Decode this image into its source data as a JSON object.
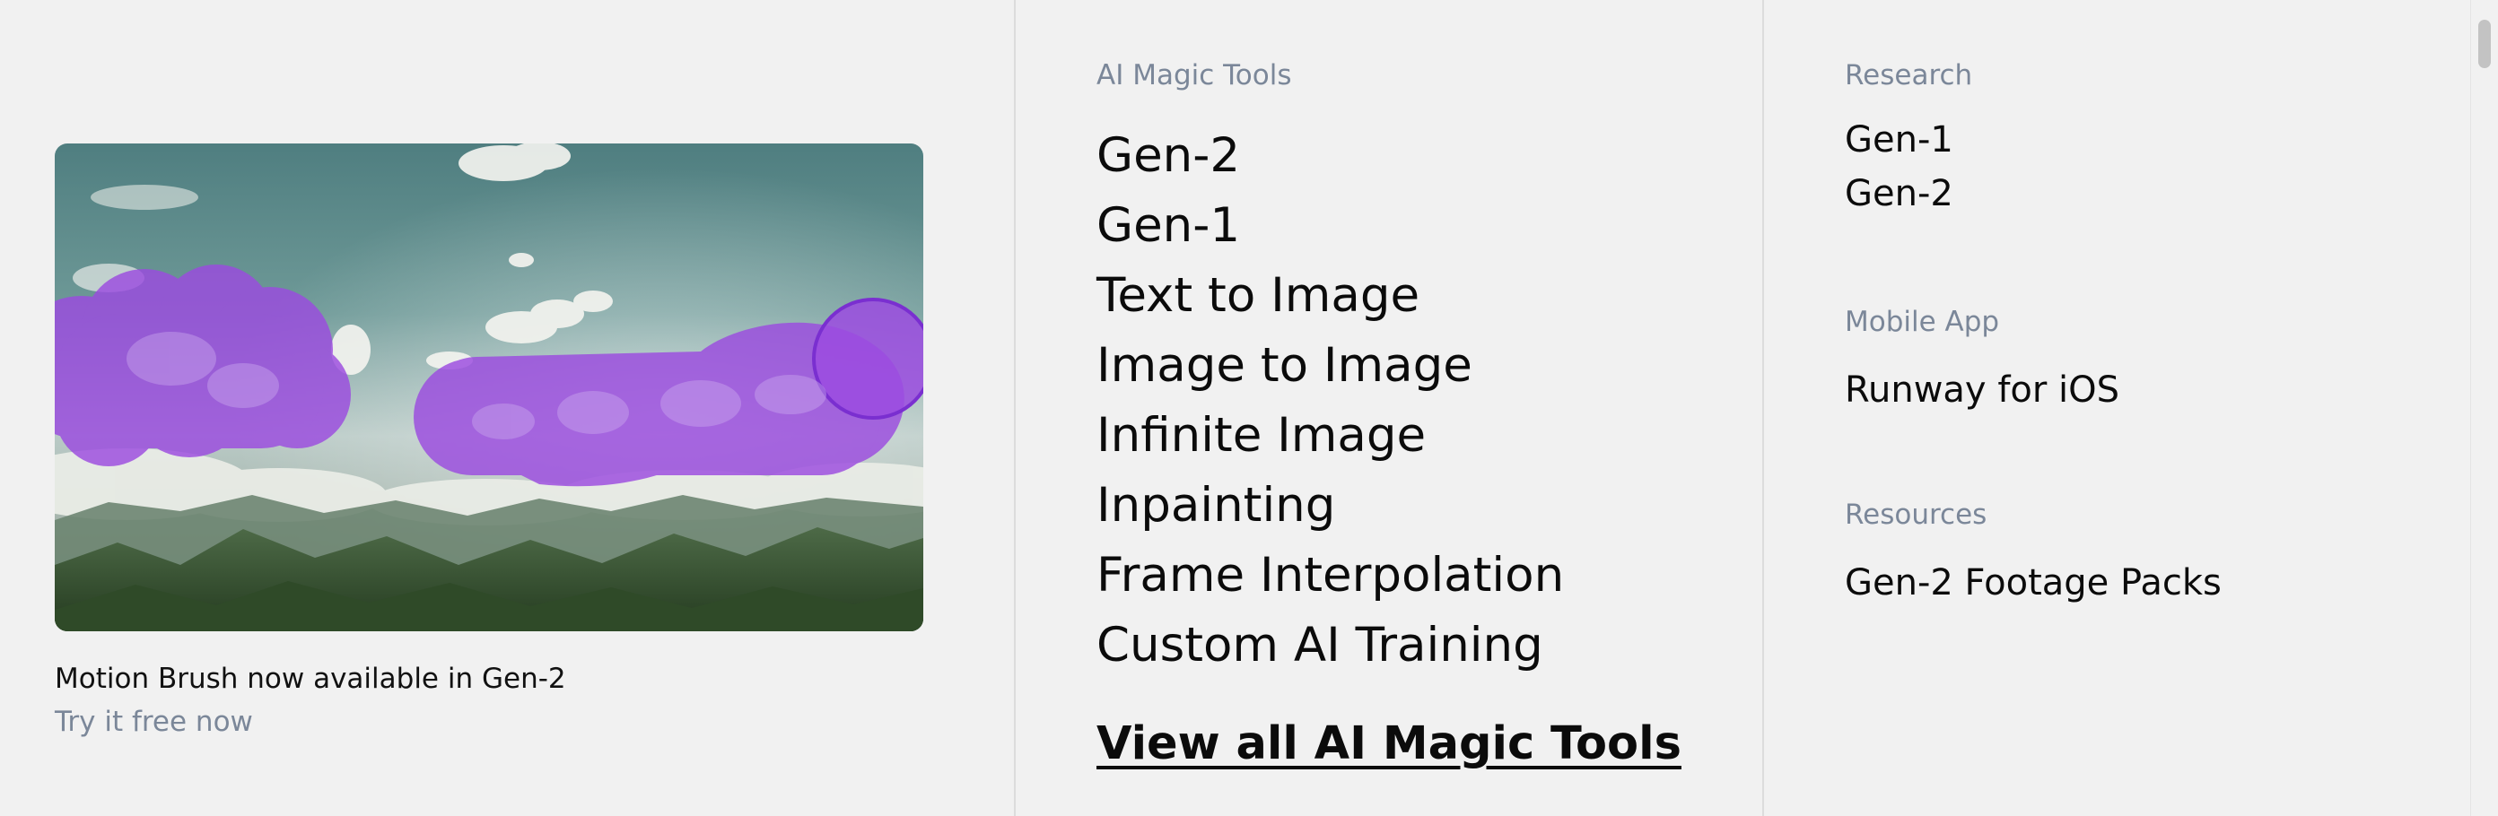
{
  "promo": {
    "image_alt": "Motion Brush preview: clouds over green mountains with purple brush strokes",
    "title": "Motion Brush now available in Gen-2",
    "cta": "Try it free now",
    "brush_color": "#9b4be0"
  },
  "ai_tools": {
    "heading": "AI Magic Tools",
    "items": [
      "Gen-2",
      "Gen-1",
      "Text to Image",
      "Image to Image",
      "Infinite Image",
      "Inpainting",
      "Frame Interpolation",
      "Custom AI Training"
    ],
    "view_all": "View all AI Magic Tools"
  },
  "research": {
    "heading": "Research",
    "items": [
      "Gen-1",
      "Gen-2"
    ]
  },
  "mobile": {
    "heading": "Mobile App",
    "items": [
      "Runway for iOS"
    ]
  },
  "resources": {
    "heading": "Resources",
    "items": [
      "Gen-2 Footage Packs"
    ]
  },
  "colors": {
    "background": "#f1f1f1",
    "muted_text": "#7b8799",
    "primary_text": "#0b0b0b",
    "divider": "#dcdcdc"
  }
}
